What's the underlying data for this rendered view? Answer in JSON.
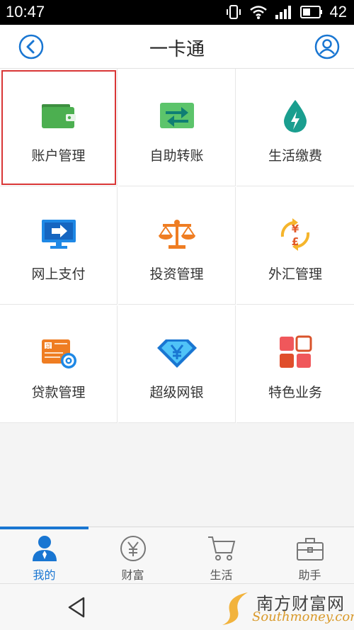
{
  "status_bar": {
    "time": "10:47",
    "battery_level": "42"
  },
  "header": {
    "title": "一卡通"
  },
  "grid": {
    "items": [
      {
        "label": "账户管理",
        "icon": "wallet-icon",
        "selected": true
      },
      {
        "label": "自助转账",
        "icon": "transfer-icon"
      },
      {
        "label": "生活缴费",
        "icon": "water-drop-icon"
      },
      {
        "label": "网上支付",
        "icon": "monitor-pay-icon"
      },
      {
        "label": "投资管理",
        "icon": "scale-icon"
      },
      {
        "label": "外汇管理",
        "icon": "currency-exchange-icon"
      },
      {
        "label": "贷款管理",
        "icon": "loan-card-icon"
      },
      {
        "label": "超级网银",
        "icon": "diamond-yen-icon"
      },
      {
        "label": "特色业务",
        "icon": "grid-squares-icon"
      }
    ]
  },
  "tabs": [
    {
      "label": "我的",
      "icon": "person-icon",
      "active": true
    },
    {
      "label": "财富",
      "icon": "yen-circle-icon"
    },
    {
      "label": "生活",
      "icon": "cart-icon"
    },
    {
      "label": "助手",
      "icon": "briefcase-icon"
    }
  ],
  "watermark": {
    "cn": "南方财富网",
    "en": "Southmoney.com"
  },
  "colors": {
    "accent_blue": "#1976d2",
    "selection_red": "#d93636",
    "wallet_green": "#4caf50",
    "teal": "#1a9e8f",
    "orange": "#ef7d22",
    "red_square": "#f0575b"
  }
}
